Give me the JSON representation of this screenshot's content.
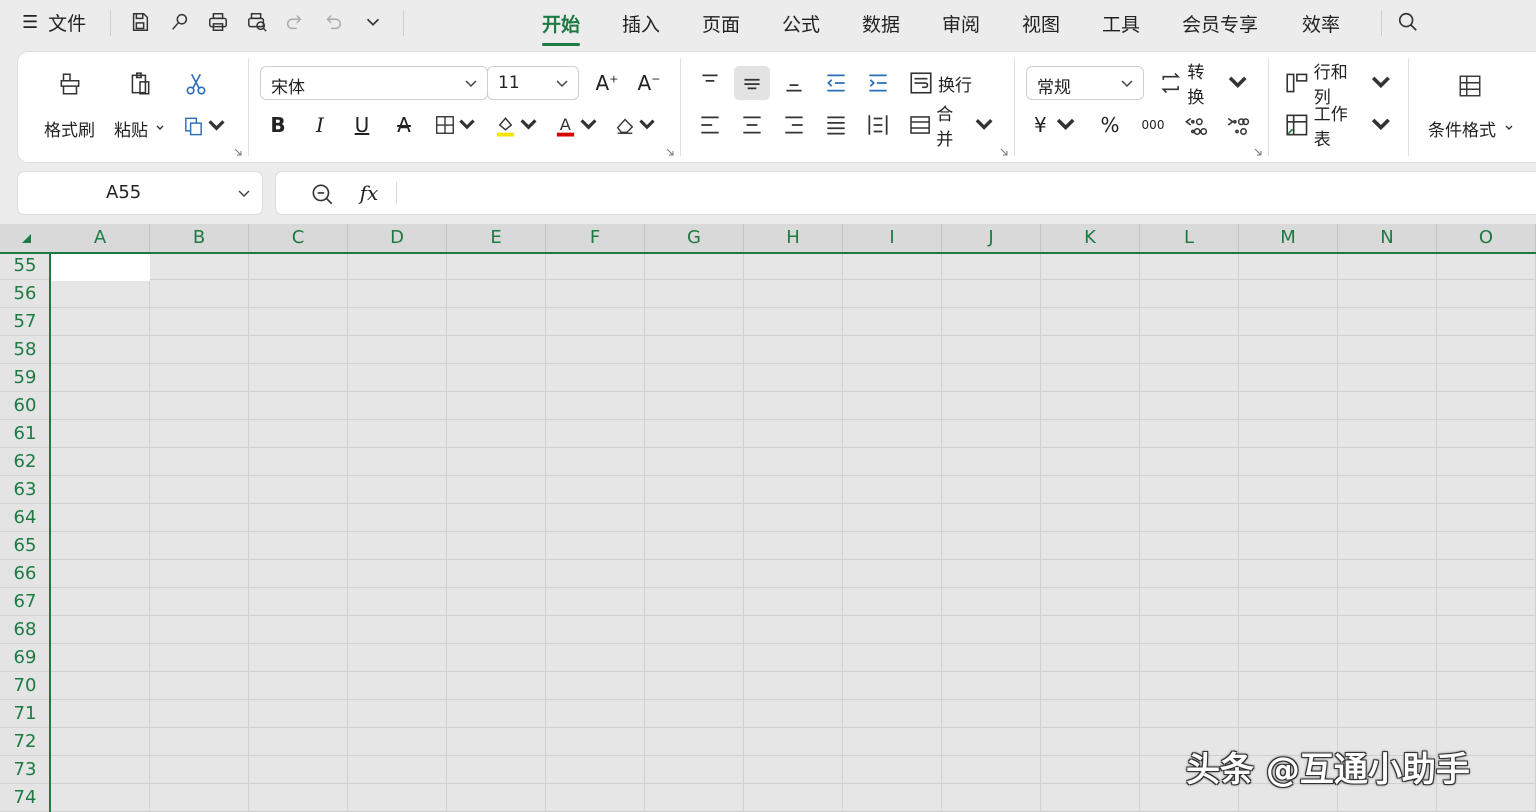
{
  "menu": {
    "file_label": "文件"
  },
  "tabs": [
    {
      "label": "开始",
      "active": true
    },
    {
      "label": "插入"
    },
    {
      "label": "页面"
    },
    {
      "label": "公式"
    },
    {
      "label": "数据"
    },
    {
      "label": "审阅"
    },
    {
      "label": "视图"
    },
    {
      "label": "工具"
    },
    {
      "label": "会员专享"
    },
    {
      "label": "效率"
    }
  ],
  "ribbon": {
    "format_painter": "格式刷",
    "paste": "粘贴",
    "font_name": "宋体",
    "font_size": "11",
    "wrap": "换行",
    "merge": "合并",
    "number_format": "常规",
    "convert": "转换",
    "rows_cols": "行和列",
    "worksheet": "工作表",
    "conditional_format": "条件格式",
    "currency_symbol": "¥",
    "percent_symbol": "%",
    "thousands_symbol": "000",
    "fill_color": "#f2e600",
    "font_color": "#d40000"
  },
  "formula_bar": {
    "cell_ref": "A55",
    "fx": "fx",
    "value": ""
  },
  "grid": {
    "columns": [
      "A",
      "B",
      "C",
      "D",
      "E",
      "F",
      "G",
      "H",
      "I",
      "J",
      "K",
      "L",
      "M",
      "N",
      "O"
    ],
    "rows": [
      "55",
      "56",
      "57",
      "58",
      "59",
      "60",
      "61",
      "62",
      "63",
      "64",
      "65",
      "66",
      "67",
      "68",
      "69",
      "70",
      "71",
      "72",
      "73",
      "74"
    ],
    "accent": "#1e7a43"
  },
  "watermark": "头条 @互通小助手"
}
